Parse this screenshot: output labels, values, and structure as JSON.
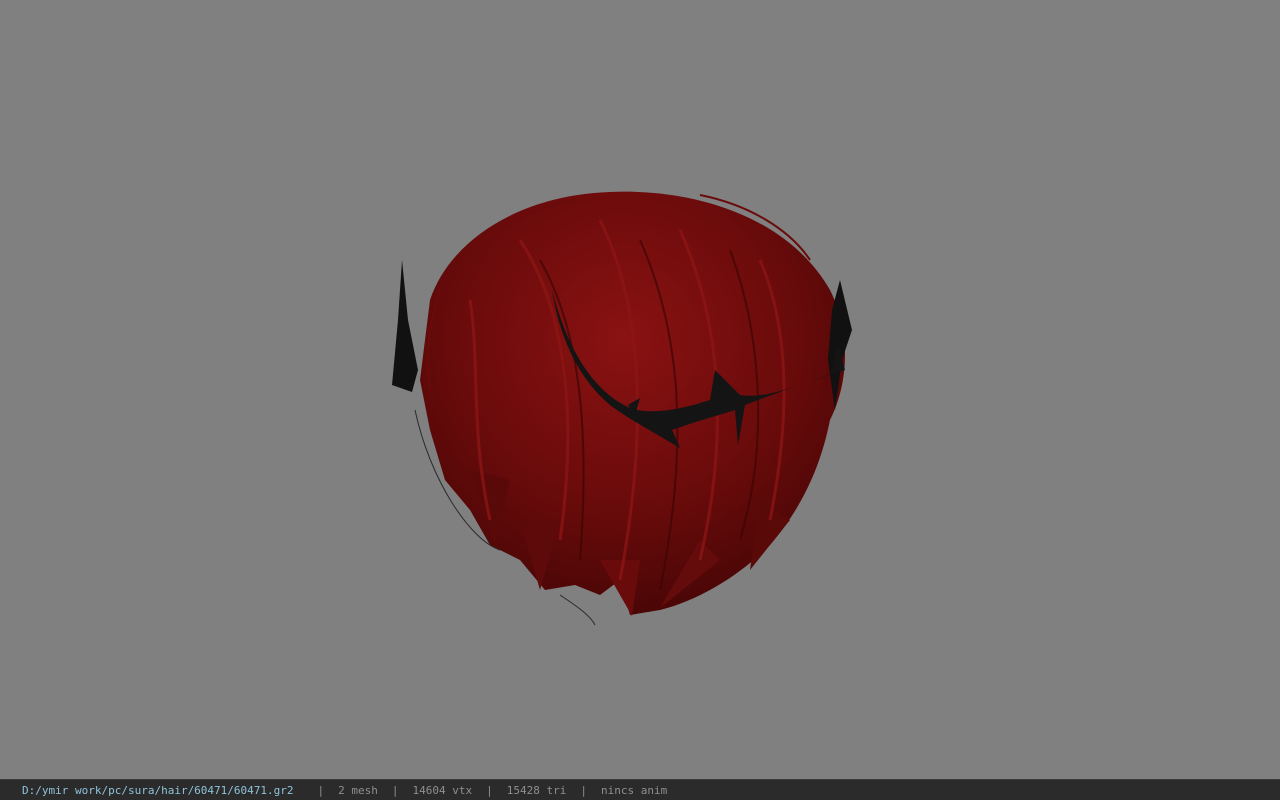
{
  "viewer": {
    "background_color": "#808080",
    "model_icon": "hair-model-icon",
    "hair_color": "#6e0b0b",
    "horn_color": "#111111"
  },
  "status": {
    "file_path": "D:/ymir work/pc/sura/hair/60471/60471.gr2",
    "separator": "|",
    "mesh": "2 mesh",
    "vtx": "14604 vtx",
    "tri": "15428 tri",
    "anim": "nincs anim"
  }
}
